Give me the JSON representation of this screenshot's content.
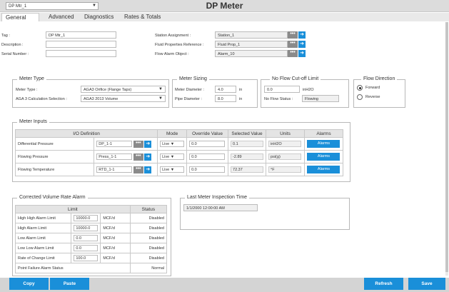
{
  "header": {
    "meter_select": "DP Mtr_1",
    "title": "DP Meter"
  },
  "tabs": [
    "General",
    "Advanced",
    "Diagnostics",
    "Rates & Totals"
  ],
  "general": {
    "tag_label": "Tag :",
    "tag_value": "DP Mtr_1",
    "description_label": "Description :",
    "description_value": "",
    "serial_label": "Serial Number :",
    "serial_value": "",
    "station_label": "Station Assignment :",
    "station_value": "Station_1",
    "fluid_label": "Fluid Properties Reference :",
    "fluid_value": "Fluid Prop_1",
    "flow_alarm_label": "Flow Alarm Object :",
    "flow_alarm_value": "Alarm_10",
    "dots": "•••",
    "arrow": "➜"
  },
  "meter_type": {
    "title": "Meter Type",
    "type_label": "Meter Type :",
    "type_value": "AGA3 Orifice (Flange Taps)",
    "calc_label": "AGA 3 Calculation Selection :",
    "calc_value": "AGA3 2013 Volume"
  },
  "meter_sizing": {
    "title": "Meter Sizing",
    "diameter_label": "Meter Diameter :",
    "diameter_value": "4.0",
    "diameter_unit": "in",
    "pipe_label": "Pipe Diameter :",
    "pipe_value": "8.0",
    "pipe_unit": "in"
  },
  "no_flow": {
    "title": "No Flow Cut-off Limit",
    "value": "0.0",
    "unit": "inH2O",
    "status_label": "No Flow Status :",
    "status_value": "Flowing"
  },
  "flow_direction": {
    "title": "Flow Direction",
    "forward": "Forward",
    "reverse": "Reverse"
  },
  "meter_inputs": {
    "title": "Meter Inputs",
    "headers": [
      "I/O Definition",
      "Mode",
      "Override Value",
      "Selected Value",
      "Units",
      "Alarms"
    ],
    "rows": [
      {
        "name": "Differential Pressure",
        "io": "DP_1-1",
        "mode": "Live",
        "override": "0.0",
        "selected": "0.1",
        "units": "inH2O",
        "alarm": "Alarms"
      },
      {
        "name": "Flowing Pressure",
        "io": "Press_1-1",
        "mode": "Live",
        "override": "0.0",
        "selected": "-2.89",
        "units": "psi(g)",
        "alarm": "Alarms"
      },
      {
        "name": "Flowing Temperature",
        "io": "RTD_1-1",
        "mode": "Live",
        "override": "0.0",
        "selected": "72.37",
        "units": "°F",
        "alarm": "Alarms"
      }
    ]
  },
  "volume_alarm": {
    "title": "Corrected Volume Rate Alarm",
    "headers": [
      "Limit",
      "Status"
    ],
    "rows": [
      {
        "name": "High High Alarm Limit",
        "value": "10000.0",
        "unit": "MCF/d",
        "status": "Disabled"
      },
      {
        "name": "High Alarm Limit",
        "value": "10000.0",
        "unit": "MCF/d",
        "status": "Disabled"
      },
      {
        "name": "Low Alarm Limit",
        "value": "0.0",
        "unit": "MCF/d",
        "status": "Disabled"
      },
      {
        "name": "Low Low Alarm Limit",
        "value": "0.0",
        "unit": "MCF/d",
        "status": "Disabled"
      },
      {
        "name": "Rate of Change Limit",
        "value": "100.0",
        "unit": "MCF/d",
        "status": "Disabled"
      },
      {
        "name": "Point Failure Alarm Status",
        "value": "",
        "unit": "",
        "status": "Normal"
      }
    ]
  },
  "inspection": {
    "title": "Last Meter Inspection Time",
    "value": "1/1/2000 12:00:00 AM"
  },
  "footer": {
    "copy": "Copy",
    "paste": "Paste",
    "refresh": "Refresh",
    "save": "Save"
  },
  "colors": {
    "accent": "#1a8fd9",
    "header_bg": "#dcdcdc",
    "footer_bg": "#d4d4d4"
  }
}
